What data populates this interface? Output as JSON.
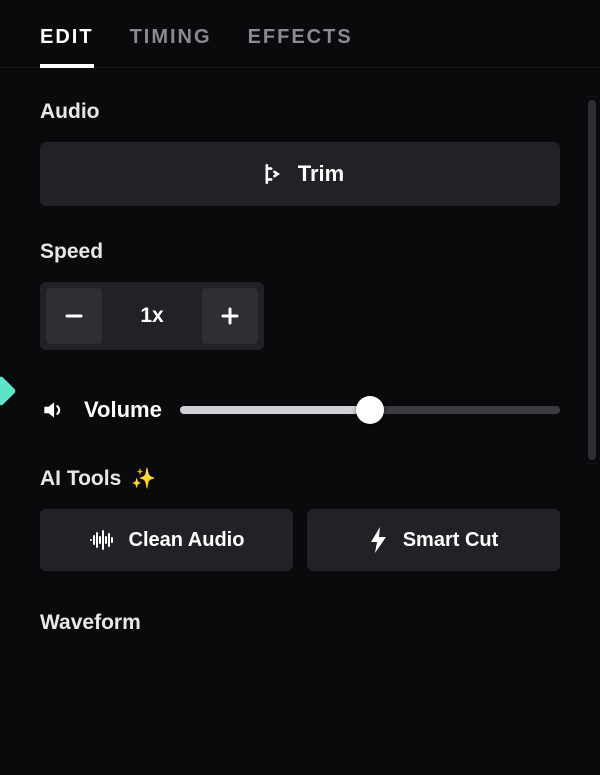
{
  "tabs": {
    "edit": "EDIT",
    "timing": "TIMING",
    "effects": "EFFECTS",
    "active": "edit"
  },
  "audio": {
    "label": "Audio",
    "trim_label": "Trim"
  },
  "speed": {
    "label": "Speed",
    "value": "1x"
  },
  "volume": {
    "label": "Volume",
    "percent": 50
  },
  "ai": {
    "label": "AI Tools",
    "clean": "Clean Audio",
    "smart": "Smart Cut"
  },
  "waveform": {
    "label": "Waveform"
  },
  "icons": {
    "sparkle": "✨"
  }
}
